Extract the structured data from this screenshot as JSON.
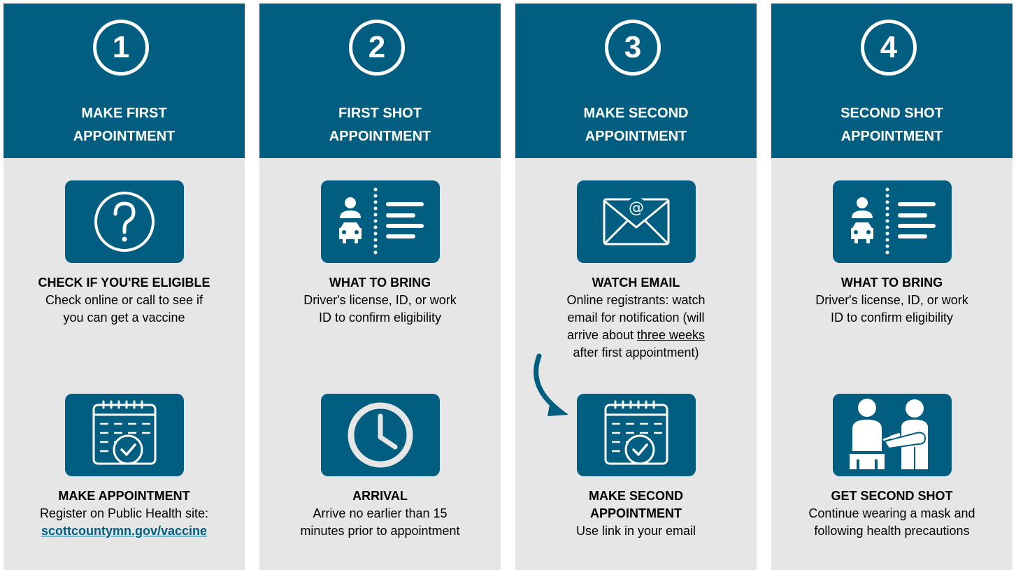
{
  "columns": [
    {
      "number": "1",
      "title_line1": "MAKE FIRST",
      "title_line2": "APPOINTMENT",
      "step1": {
        "icon": "question-icon",
        "label": "CHECK IF YOU'RE ELIGIBLE",
        "line1": "Check online or call to see if",
        "line2": "you can get a vaccine"
      },
      "step2": {
        "icon": "calendar-check-icon",
        "label": "MAKE APPOINTMENT",
        "line1": "Register on Public Health site:",
        "link": "scottcountymn.gov/vaccine"
      }
    },
    {
      "number": "2",
      "title_line1": "FIRST SHOT",
      "title_line2": "APPOINTMENT",
      "step1": {
        "icon": "id-card-icon",
        "label": "WHAT TO BRING",
        "line1": "Driver's license, ID, or work",
        "line2": "ID to confirm eligibility"
      },
      "step2": {
        "icon": "clock-icon",
        "label": "ARRIVAL",
        "line1": "Arrive no earlier than 15",
        "line2": "minutes prior to appointment"
      }
    },
    {
      "number": "3",
      "title_line1": "MAKE SECOND",
      "title_line2": "APPOINTMENT",
      "step1": {
        "icon": "email-icon",
        "label": "WATCH EMAIL",
        "line1": "Online registrants: watch",
        "line2": "email for notification (will",
        "line3_pre": "arrive about ",
        "line3_underlined": "three weeks",
        "line4": "after first appointment)"
      },
      "step2": {
        "icon": "calendar-check-icon",
        "label_line1": "MAKE SECOND",
        "label_line2": "APPOINTMENT",
        "line1": "Use link in your email"
      }
    },
    {
      "number": "4",
      "title_line1": "SECOND SHOT",
      "title_line2": "APPOINTMENT",
      "step1": {
        "icon": "id-card-icon",
        "label": "WHAT TO BRING",
        "line1": "Driver's license, ID, or work",
        "line2": "ID to confirm eligibility"
      },
      "step2": {
        "icon": "vaccination-icon",
        "label": "GET SECOND SHOT",
        "line1": "Continue wearing a mask and",
        "line2": "following health precautions"
      }
    }
  ],
  "colors": {
    "brand": "#015e81",
    "panel": "#e6e6e6",
    "text": "#000000"
  }
}
